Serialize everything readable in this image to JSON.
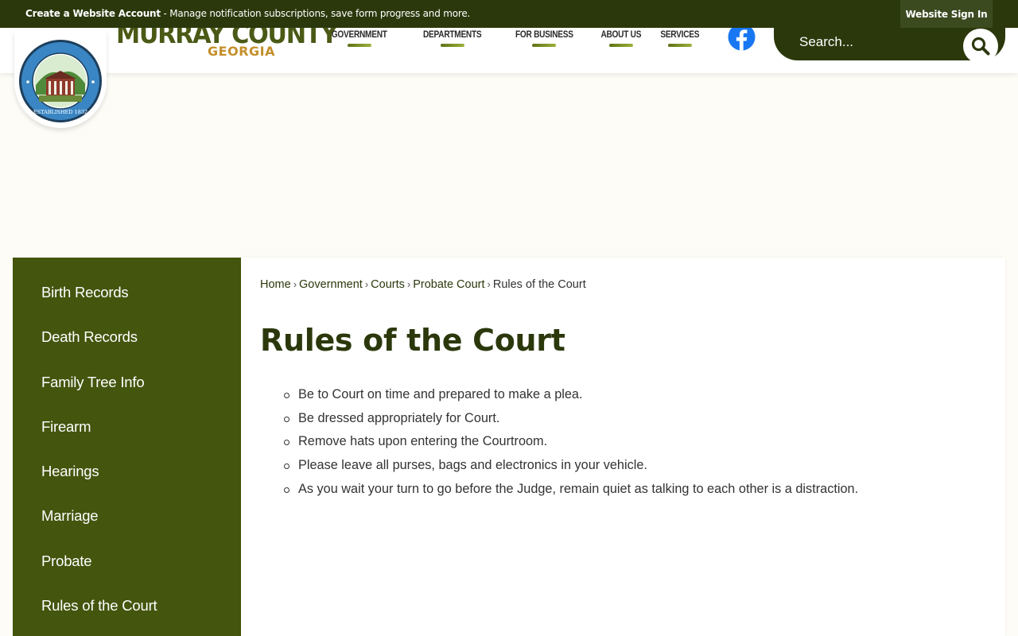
{
  "topbar": {
    "create_account_bold": "Create a Website Account",
    "create_account_rest": " - Manage notification subscriptions, save form progress and more.",
    "signin_label": "Website Sign In"
  },
  "header": {
    "brand_name": "MURRAY COUNTY",
    "brand_sub": "GEORGIA",
    "seal_established": "ESTABLISHED 1832",
    "nav": [
      {
        "label": "GOVERNMENT"
      },
      {
        "label": "DEPARTMENTS"
      },
      {
        "label": "FOR BUSINESS"
      },
      {
        "label": "ABOUT US"
      },
      {
        "label": "SERVICES"
      }
    ],
    "social_icon": "facebook-icon",
    "search": {
      "placeholder": "Search...",
      "button_icon": "search-icon"
    }
  },
  "sidebar": {
    "items": [
      {
        "label": "Birth Records"
      },
      {
        "label": "Death Records"
      },
      {
        "label": "Family Tree Info"
      },
      {
        "label": "Firearm"
      },
      {
        "label": "Hearings"
      },
      {
        "label": "Marriage"
      },
      {
        "label": "Probate"
      },
      {
        "label": "Rules of the Court"
      }
    ]
  },
  "main": {
    "breadcrumb": [
      "Home",
      "Government",
      "Courts",
      "Probate Court",
      "Rules of the Court"
    ],
    "breadcrumb_separator": "›",
    "title": "Rules of the Court",
    "rules": [
      "Be to Court on time and prepared to make a plea.",
      "Be dressed appropriately for Court.",
      "Remove hats upon entering the Courtroom.",
      "Please leave all purses, bags and electronics in your vehicle.",
      "As you wait your turn to go before the Judge, remain quiet as talking to each other is a distraction."
    ]
  },
  "colors": {
    "dark_green": "#2b380c",
    "sidebar_green": "#44550e",
    "accent_gold": "#c48f2a",
    "nav_bar_green": "#7a8f22",
    "facebook_blue": "#1877f2"
  }
}
